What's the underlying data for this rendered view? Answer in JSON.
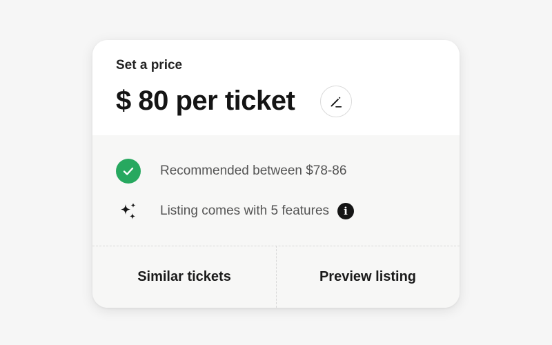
{
  "pricing_card": {
    "label": "Set a price",
    "price": "$ 80 per ticket",
    "recommendation": "Recommended between $78-86",
    "features_text": "Listing comes with 5 features",
    "info_glyph": "i",
    "similar_button": "Similar tickets",
    "preview_button": "Preview listing"
  },
  "icons": {
    "edit": "pencil-icon",
    "check": "check-circle-icon",
    "sparkle": "sparkle-icon",
    "info": "info-icon"
  },
  "colors": {
    "success": "#27a85f",
    "text_primary": "#141414",
    "text_secondary": "#545454"
  }
}
